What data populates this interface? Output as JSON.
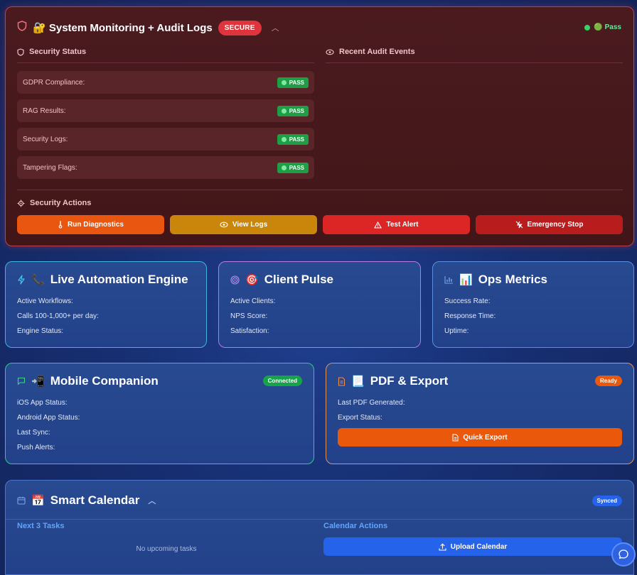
{
  "security": {
    "title": "🔐 System Monitoring + Audit Logs",
    "badge": "SECURE",
    "top_status": "🟢 Pass",
    "status_heading": "Security Status",
    "audit_heading": "Recent Audit Events",
    "rows": [
      {
        "label": "GDPR Compliance:",
        "badge": "PASS"
      },
      {
        "label": "RAG Results:",
        "badge": "PASS"
      },
      {
        "label": "Security Logs:",
        "badge": "PASS"
      },
      {
        "label": "Tampering Flags:",
        "badge": "PASS"
      }
    ],
    "actions_heading": "Security Actions",
    "actions": [
      {
        "label": "Run Diagnostics",
        "color": "#e8560f"
      },
      {
        "label": "View Logs",
        "color": "#c9860b"
      },
      {
        "label": "Test Alert",
        "color": "#dc2626"
      },
      {
        "label": "Emergency Stop",
        "color": "#b91c1c"
      }
    ]
  },
  "automation": {
    "title": "Live Automation Engine",
    "emoji": "📞",
    "fields": [
      "Active Workflows:",
      "Calls 100-1,000+ per day:",
      "Engine Status:"
    ],
    "border_color": "#3fb6e0"
  },
  "client_pulse": {
    "title": "Client Pulse",
    "emoji": "🎯",
    "fields": [
      "Active Clients:",
      "NPS Score:",
      "Satisfaction:"
    ],
    "border_color": "#b57ae6"
  },
  "ops": {
    "title": "Ops Metrics",
    "emoji": "📊",
    "fields": [
      "Success Rate:",
      "Response Time:",
      "Uptime:"
    ],
    "border_color": "#5b8ee0"
  },
  "mobile": {
    "title": "Mobile Companion",
    "emoji": "📲",
    "badge": "Connected",
    "badge_color": "#16a34a",
    "fields": [
      "iOS App Status:",
      "Android App Status:",
      "Last Sync:",
      "Push Alerts:"
    ],
    "border_color": "#34c98a"
  },
  "pdf": {
    "title": "PDF & Export",
    "emoji": "📃",
    "badge": "Ready",
    "badge_color": "#ea580c",
    "fields": [
      "Last PDF Generated:",
      "Export Status:"
    ],
    "button": "Quick Export",
    "border_color": "#e3935a"
  },
  "calendar": {
    "title": "Smart Calendar",
    "emoji": "📅",
    "badge": "Synced",
    "badge_color": "#2563eb",
    "tasks_heading": "Next 3 Tasks",
    "empty_text": "No upcoming tasks",
    "actions_heading": "Calendar Actions",
    "upload_button": "Upload Calendar",
    "border_color": "#4d75c9"
  },
  "colors": {
    "accent_blue": "#60a5fa",
    "pass_green": "#1e9e45",
    "secure_red": "#e0343c"
  }
}
